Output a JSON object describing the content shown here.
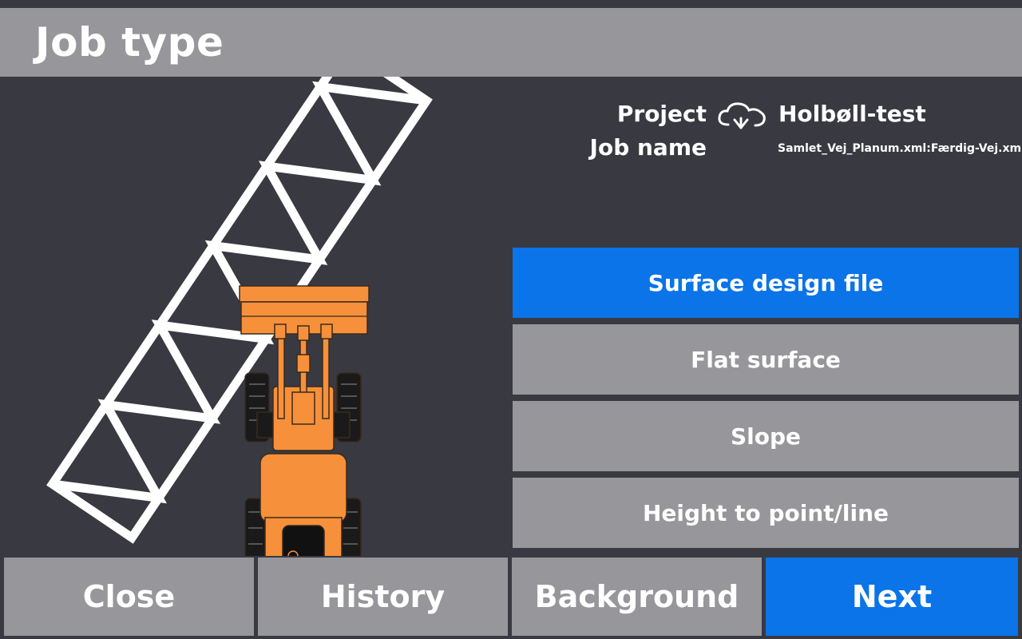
{
  "header": {
    "title": "Job type"
  },
  "info": {
    "project_label": "Project",
    "project_value": "Holbøll-test",
    "job_label": "Job name",
    "job_value": "Samlet_Vej_Planum.xml:Færdig-Vej.xml",
    "project_icon": "cloud-sync-icon"
  },
  "options": [
    {
      "label": "Surface design file",
      "selected": true
    },
    {
      "label": "Flat surface",
      "selected": false
    },
    {
      "label": "Slope",
      "selected": false
    },
    {
      "label": "Height to point/line",
      "selected": false
    }
  ],
  "footer": {
    "close_label": "Close",
    "history_label": "History",
    "background_label": "Background",
    "next_label": "Next"
  },
  "colors": {
    "background": "#393942",
    "gray_button": "#96969b",
    "accent_blue": "#0a74e8",
    "machine_orange": "#f7903a"
  },
  "illustration": {
    "icon": "wheel-loader-on-design-surface-icon"
  }
}
